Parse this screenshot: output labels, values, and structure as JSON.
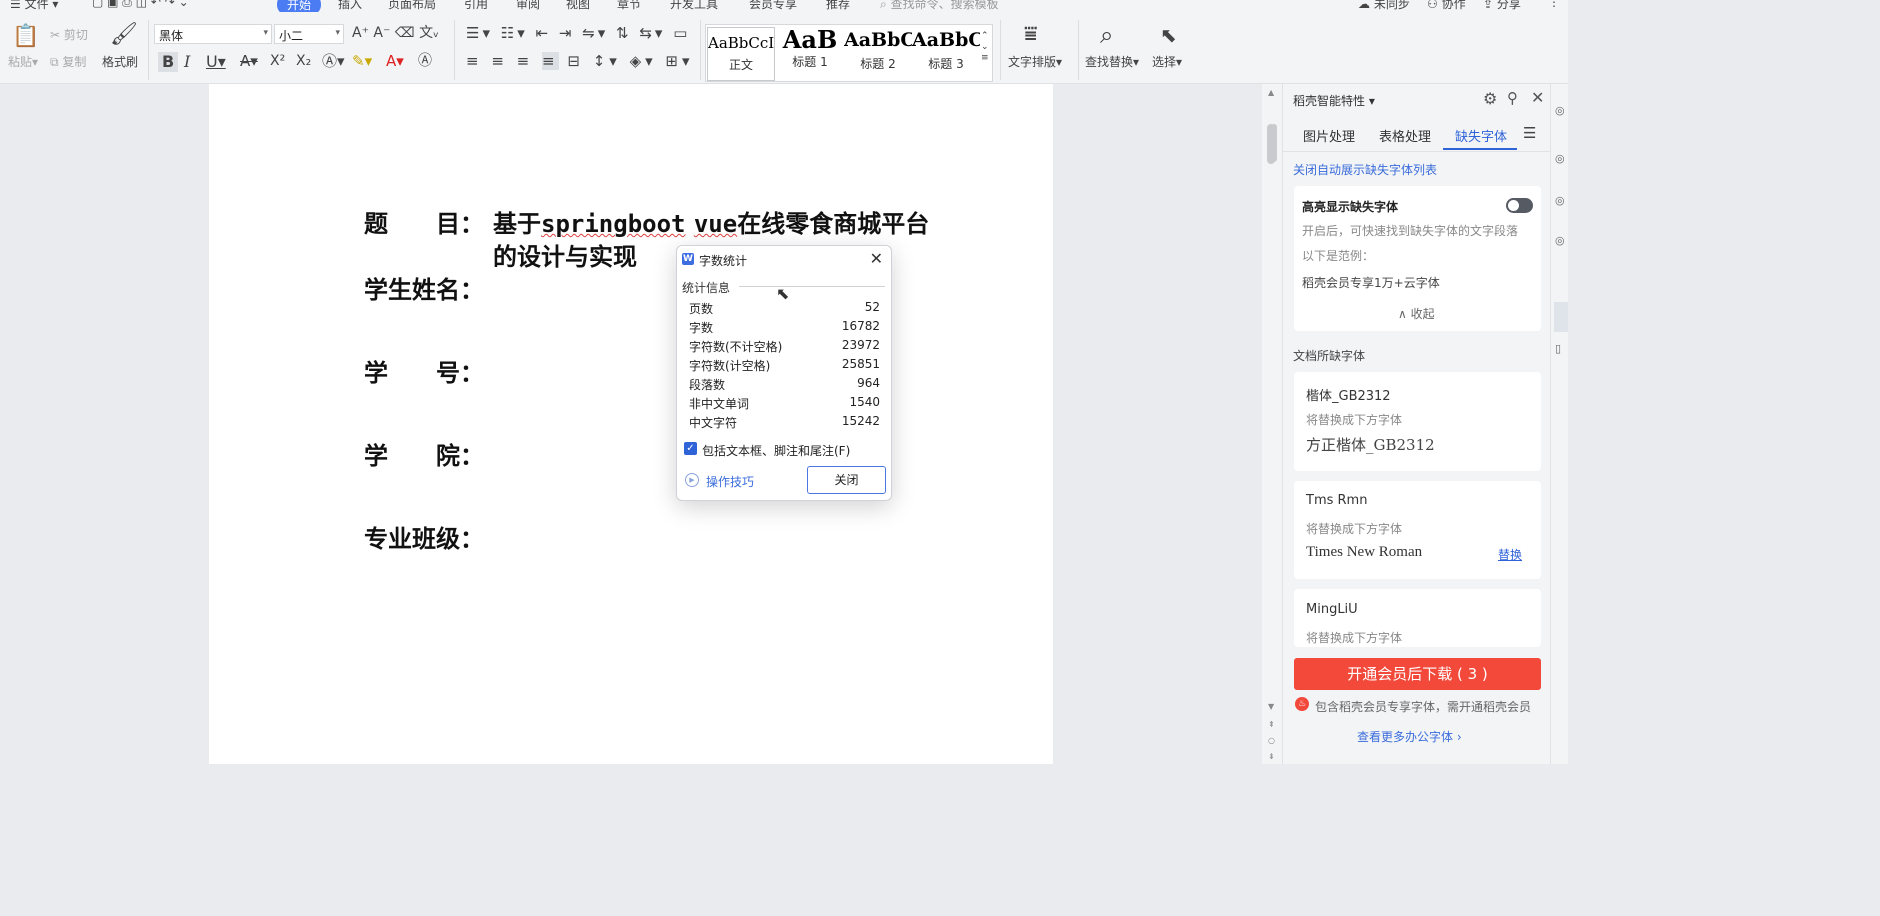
{
  "menu": {
    "file": "文件",
    "tabs": [
      "开始",
      "插入",
      "页面布局",
      "引用",
      "审阅",
      "视图",
      "章节",
      "开发工具",
      "会员专享",
      "推荐"
    ],
    "search_placeholder": "查找命令、搜索模板",
    "right": [
      "未同步",
      "协作",
      "分享"
    ]
  },
  "ribbon": {
    "paste": "粘贴",
    "cut": "剪切",
    "copy": "复制",
    "format_painter": "格式刷",
    "font_name": "黑体",
    "font_size": "小二",
    "styles": [
      {
        "preview": "AaBbCcI",
        "name": "正文"
      },
      {
        "preview": "AaB",
        "name": "标题 1"
      },
      {
        "preview": "AaBbC",
        "name": "标题 2"
      },
      {
        "preview": "AaBbC",
        "name": "标题 3"
      }
    ],
    "text_layout": "文字排版",
    "find_replace": "查找替换",
    "select": "选择"
  },
  "document": {
    "title_label": "题　　目：",
    "title_p1": "基于",
    "title_p2": "springboot",
    "title_p3": "vue",
    "title_p4": "在线零食商城平台",
    "title_line2": "的设计与实现",
    "student_name": "学生姓名：",
    "student_id": "学　　号：",
    "college": "学　　院：",
    "major_class": "专业班级："
  },
  "dialog": {
    "title": "字数统计",
    "section": "统计信息",
    "rows": [
      {
        "label": "页数",
        "value": "52"
      },
      {
        "label": "字数",
        "value": "16782"
      },
      {
        "label": "字符数(不计空格)",
        "value": "23972"
      },
      {
        "label": "字符数(计空格)",
        "value": "25851"
      },
      {
        "label": "段落数",
        "value": "964"
      },
      {
        "label": "非中文单词",
        "value": "1540"
      },
      {
        "label": "中文字符",
        "value": "15242"
      }
    ],
    "checkbox": "包括文本框、脚注和尾注(F)",
    "tips": "操作技巧",
    "close": "关闭"
  },
  "panel": {
    "title": "稻壳智能特性",
    "tabs": [
      "图片处理",
      "表格处理",
      "缺失字体"
    ],
    "close_auto": "关闭自动展示缺失字体列表",
    "highlight": "高亮显示缺失字体",
    "desc": "开启后，可快速找到缺失字体的文字段落",
    "example_label": "以下是范例：",
    "example": "稻壳会员专享1万+云字体",
    "collapse": "收起",
    "missing_header": "文档所缺字体",
    "fonts": [
      {
        "name": "楷体_GB2312",
        "hint": "将替换成下方字体",
        "replacement": "方正楷体_GB2312",
        "action": ""
      },
      {
        "name": "Tms Rmn",
        "hint": "将替换成下方字体",
        "replacement": "Times New Roman",
        "action": "替换"
      },
      {
        "name": "MingLiU",
        "hint": "将替换成下方字体",
        "replacement": "",
        "action": ""
      }
    ],
    "cta": "开通会员后下载 ( 3 )",
    "notice": "包含稻壳会员专享字体，需开通稻壳会员",
    "more": "查看更多办公字体 ›"
  }
}
